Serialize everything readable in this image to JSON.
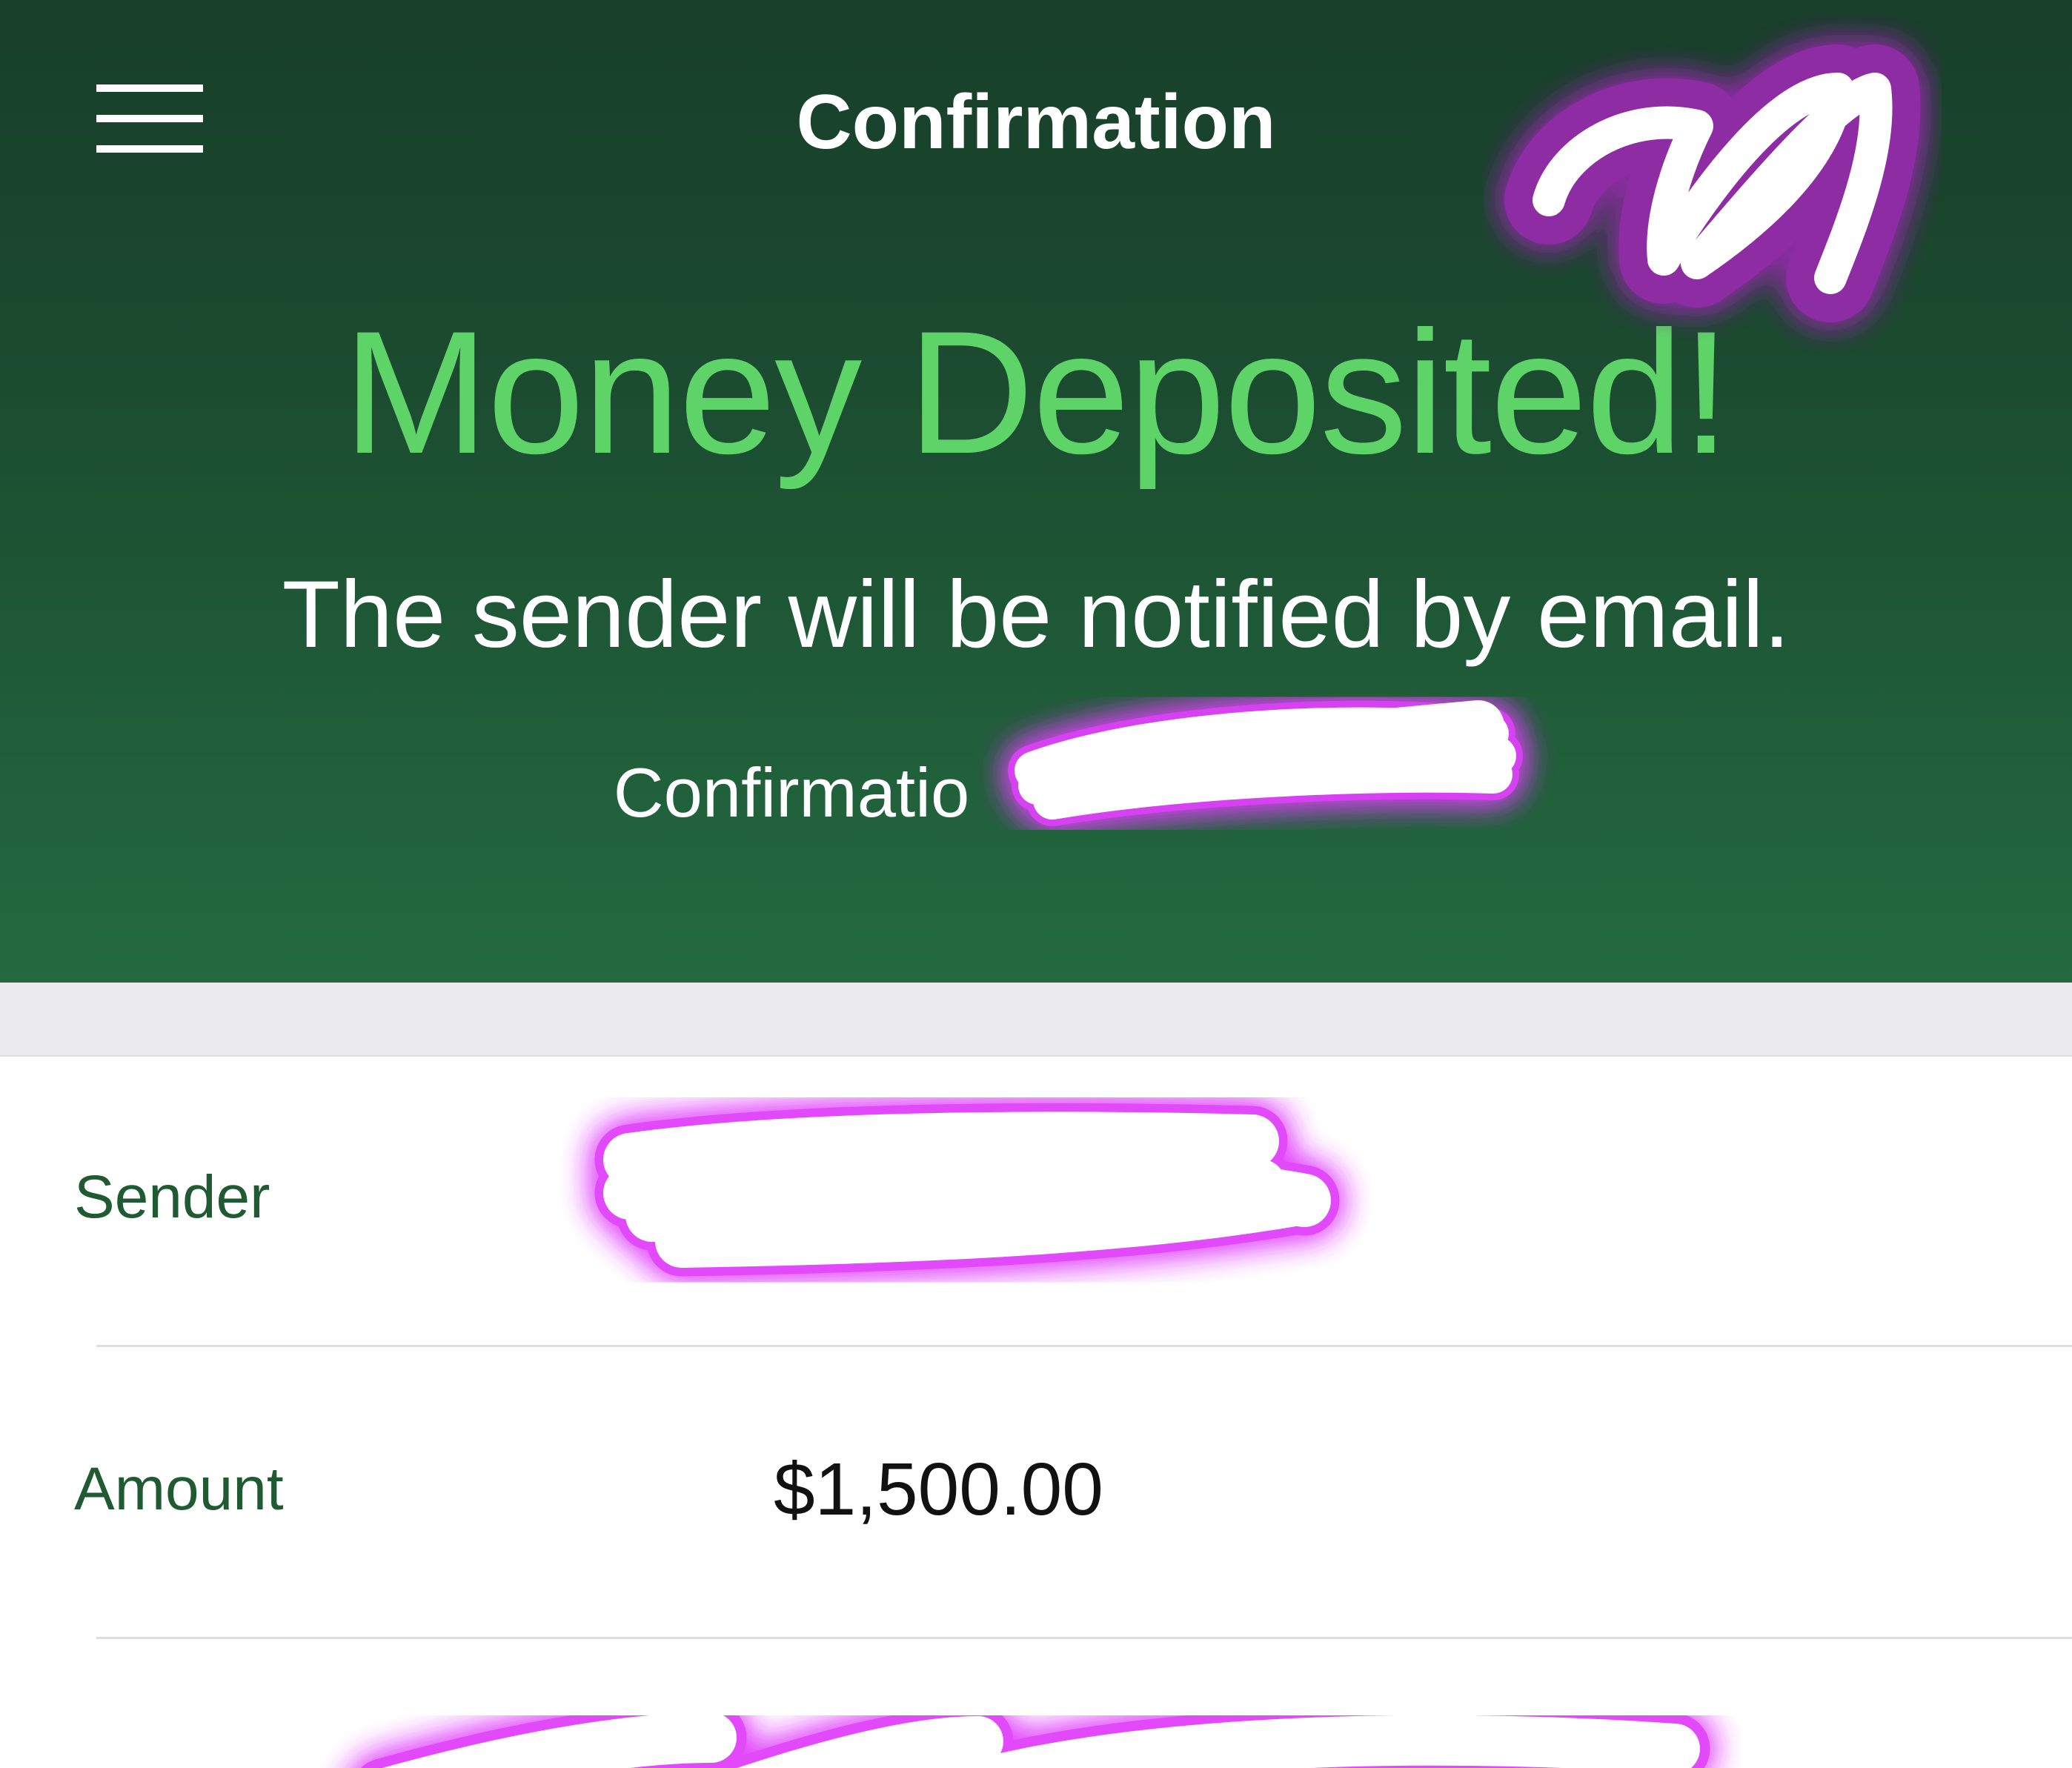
{
  "nav": {
    "title": "Confirmation",
    "menu_icon": "hamburger-menu-icon"
  },
  "banner": {
    "headline": "Money Deposited!",
    "subtitle": "The sender will be notified by email.",
    "confirmation_prefix": "Confirmatio"
  },
  "details": {
    "rows": [
      {
        "label": "Sender",
        "value": ""
      },
      {
        "label": "Amount",
        "value": "$1,500.00"
      }
    ]
  },
  "colors": {
    "header_dark": "#183f2a",
    "header_light": "#236a40",
    "headline_green": "#5ed468",
    "label_green": "#1f5a33",
    "redaction_glow": "#e040fb"
  }
}
